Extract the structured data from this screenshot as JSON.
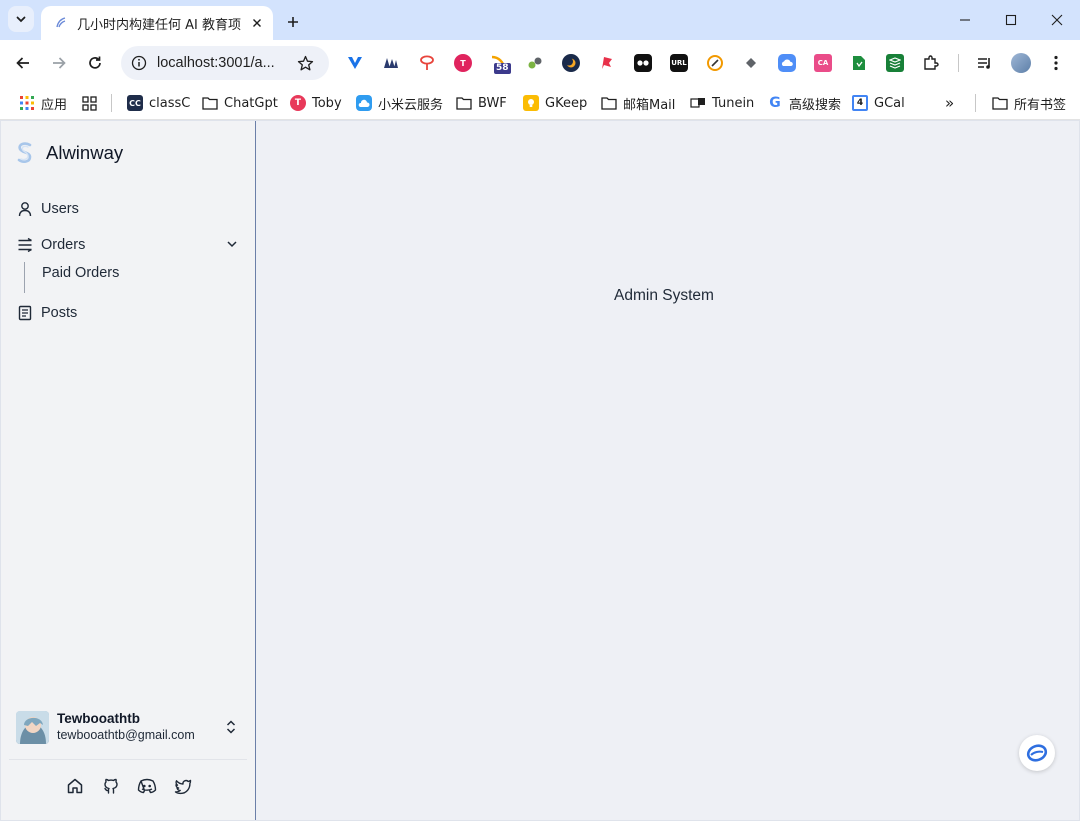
{
  "browser": {
    "tab_title": "几小时内构建任何 AI 教育项目",
    "url": "localhost:3001/a...",
    "bookmarks": [
      {
        "label": "应用",
        "icon": "apps-grid-icon"
      },
      {
        "label": "",
        "icon": "tab-groups-icon"
      },
      {
        "label": "classC",
        "icon": "classc-icon"
      },
      {
        "label": "ChatGpt",
        "icon": "folder-icon"
      },
      {
        "label": "Toby",
        "icon": "toby-icon"
      },
      {
        "label": "小米云服务",
        "icon": "xiaomi-cloud-icon"
      },
      {
        "label": "BWF",
        "icon": "folder-icon"
      },
      {
        "label": "GKeep",
        "icon": "gkeep-icon"
      },
      {
        "label": "邮箱Mail",
        "icon": "folder-icon"
      },
      {
        "label": "Tunein",
        "icon": "tunein-icon"
      },
      {
        "label": "高级搜索",
        "icon": "google-icon"
      },
      {
        "label": "GCal",
        "icon": "gcal-icon"
      }
    ],
    "bookmarks_more": "»",
    "all_bookmarks": "所有书签",
    "extension_badge": "58"
  },
  "app": {
    "brand": "Alwinway",
    "nav": {
      "users": "Users",
      "orders": "Orders",
      "paid_orders": "Paid Orders",
      "posts": "Posts"
    },
    "user": {
      "name": "Tewbooathtb",
      "email": "tewbooathtb@gmail.com"
    },
    "main_text": "Admin System"
  }
}
